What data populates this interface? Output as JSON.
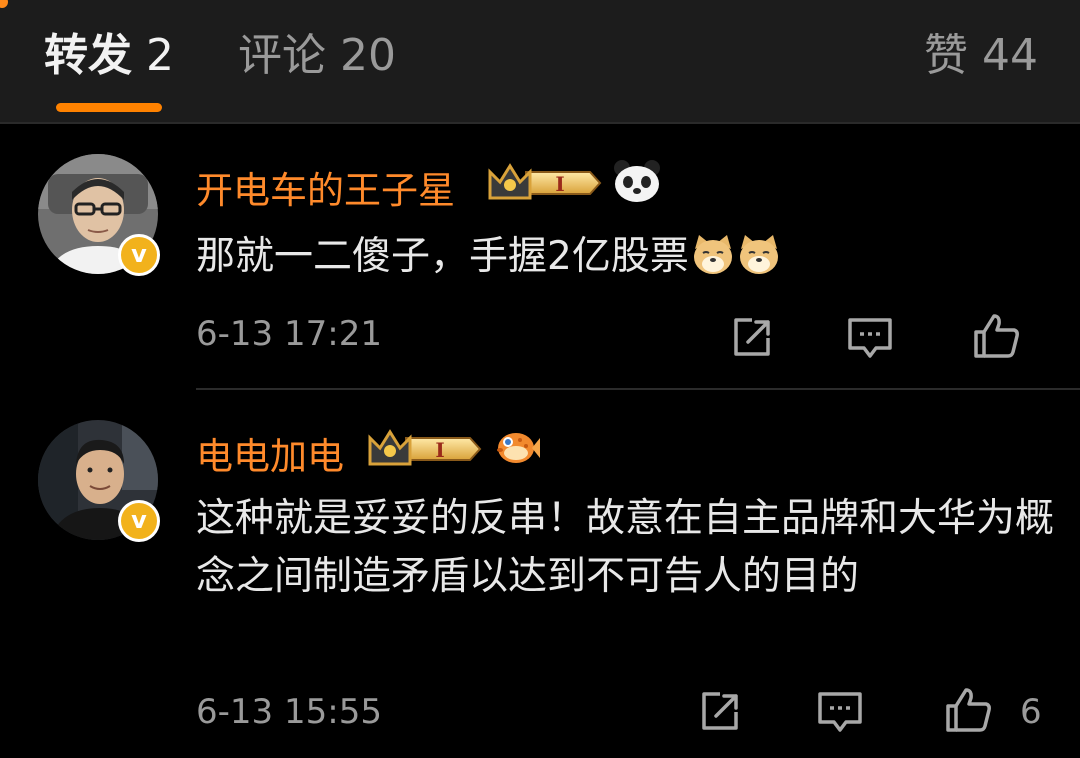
{
  "tabs": {
    "repost": {
      "label": "转发",
      "count": "2"
    },
    "comments": {
      "label": "评论",
      "count": "20"
    },
    "likes": {
      "label": "赞",
      "count": "44"
    }
  },
  "colors": {
    "accent": "#ff8200",
    "username": "#ff8a2b",
    "verified_badge": "#f2b21c"
  },
  "comments": [
    {
      "username": "开电车的王子星",
      "badge_icon": "crown-level-badge",
      "badge_text": "I",
      "emoji_badge": "panda-icon",
      "text": "那就一二傻子，手握2亿股票",
      "inline_emojis": [
        "doge-emoji",
        "doge-emoji"
      ],
      "time": "6-13 17:21",
      "like_count": ""
    },
    {
      "username": "电电加电",
      "badge_icon": "crown-level-badge",
      "badge_text": "I",
      "emoji_badge": "pufferfish-icon",
      "text": "这种就是妥妥的反串！故意在自主品牌和大华为概念之间制造矛盾以达到不可告人的目的",
      "inline_emojis": [],
      "time": "6-13 15:55",
      "like_count": "6"
    }
  ]
}
